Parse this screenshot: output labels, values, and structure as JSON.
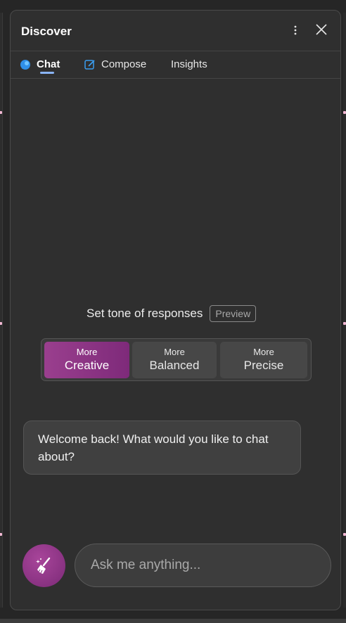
{
  "header": {
    "title": "Discover"
  },
  "tabs": [
    {
      "label": "Chat",
      "icon": "chat-bubble-icon",
      "active": true
    },
    {
      "label": "Compose",
      "icon": "compose-icon",
      "active": false
    },
    {
      "label": "Insights",
      "icon": "",
      "active": false
    }
  ],
  "tone": {
    "label": "Set tone of responses",
    "badge": "Preview",
    "options": [
      {
        "prefix": "More",
        "name": "Creative",
        "selected": true
      },
      {
        "prefix": "More",
        "name": "Balanced",
        "selected": false
      },
      {
        "prefix": "More",
        "name": "Precise",
        "selected": false
      }
    ]
  },
  "chat": {
    "welcome": "Welcome back! What would you like to chat about?"
  },
  "input": {
    "placeholder": "Ask me anything..."
  },
  "colors": {
    "accent_creative": "#9a3f8e",
    "tab_underline": "#8ab4f8",
    "chat_icon": "#2f8fe8",
    "compose_icon": "#3a9ef0"
  }
}
